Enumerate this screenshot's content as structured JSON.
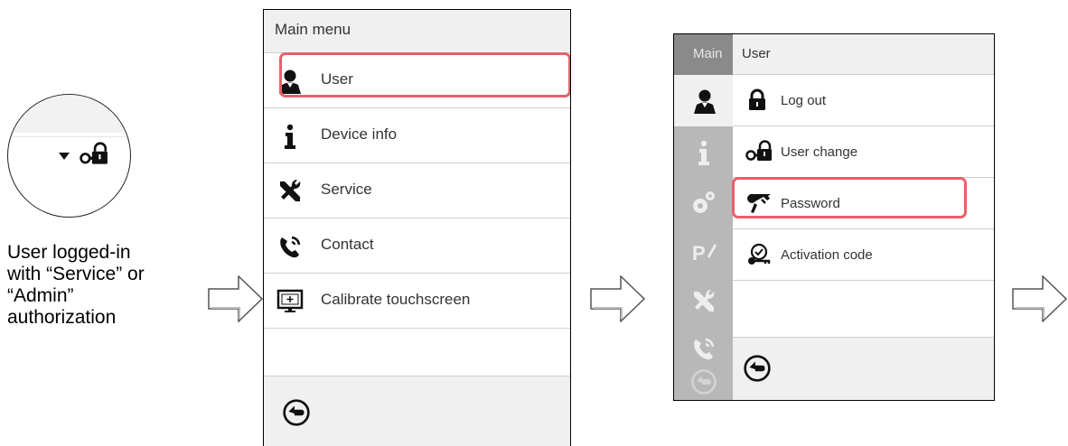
{
  "caption": {
    "line1": "User logged-in",
    "line2": "with “Service” or",
    "line3": "“Admin”",
    "line4": "authorization"
  },
  "main_menu": {
    "title": "Main menu",
    "items": [
      {
        "label": "User",
        "icon": "user-icon",
        "highlighted": true
      },
      {
        "label": "Device info",
        "icon": "info-icon"
      },
      {
        "label": "Service",
        "icon": "tools-icon"
      },
      {
        "label": "Contact",
        "icon": "phone-icon"
      },
      {
        "label": "Calibrate touchscreen",
        "icon": "touchscreen-icon"
      }
    ],
    "footer_icon": "back-icon"
  },
  "user_menu": {
    "rail_title": "Main",
    "title": "User",
    "rail_icons": [
      "user-icon",
      "info-icon",
      "settings-icon",
      "program-icon",
      "tools-icon",
      "phone-icon",
      "back-icon"
    ],
    "items": [
      {
        "label": "Log out",
        "icon": "lock-icon"
      },
      {
        "label": "User change",
        "icon": "user-change-icon"
      },
      {
        "label": "Password",
        "icon": "password-key-icon",
        "highlighted": true
      },
      {
        "label": "Activation code",
        "icon": "activation-icon"
      }
    ],
    "footer_icon": "back-icon"
  },
  "colors": {
    "highlight": "#e8606a",
    "header_bg": "#f0f0f0",
    "rail_bg": "#b8b8b8",
    "rail_head_bg": "#8a8a8a"
  }
}
